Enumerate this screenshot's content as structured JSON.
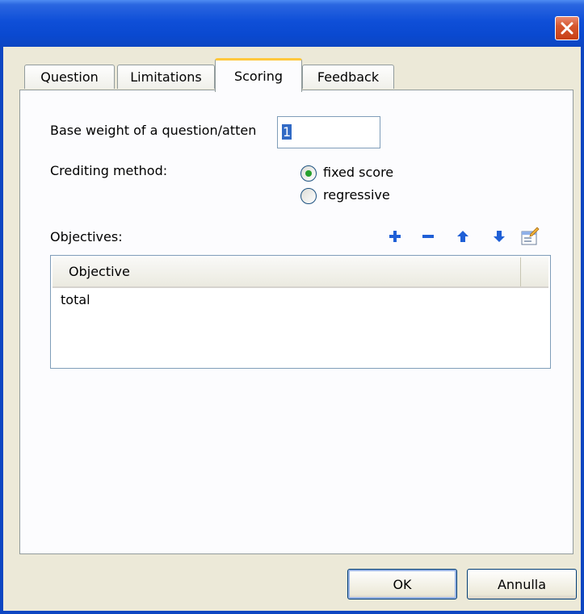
{
  "window": {
    "close_icon": "close-icon"
  },
  "tabs": [
    {
      "label": "Question",
      "active": false
    },
    {
      "label": "Limitations",
      "active": false
    },
    {
      "label": "Scoring",
      "active": true
    },
    {
      "label": "Feedback",
      "active": false
    }
  ],
  "scoring": {
    "base_weight_label": "Base weight of a question/atten",
    "base_weight_value": "1",
    "crediting_label": "Crediting method:",
    "options": [
      {
        "label": "fixed score",
        "selected": true
      },
      {
        "label": "regressive",
        "selected": false
      }
    ]
  },
  "objectives": {
    "label": "Objectives:",
    "toolbar": [
      "add-icon",
      "remove-icon",
      "move-up-icon",
      "move-down-icon",
      "properties-icon"
    ],
    "column_header": "Objective",
    "rows": [
      "total"
    ]
  },
  "buttons": {
    "ok": "OK",
    "cancel": "Annulla"
  },
  "colors": {
    "titlebar": "#0a49d0",
    "active_tab_accent": "#ffc83c",
    "selection": "#316ac5",
    "toolbar_icon": "#1f5fd6"
  }
}
